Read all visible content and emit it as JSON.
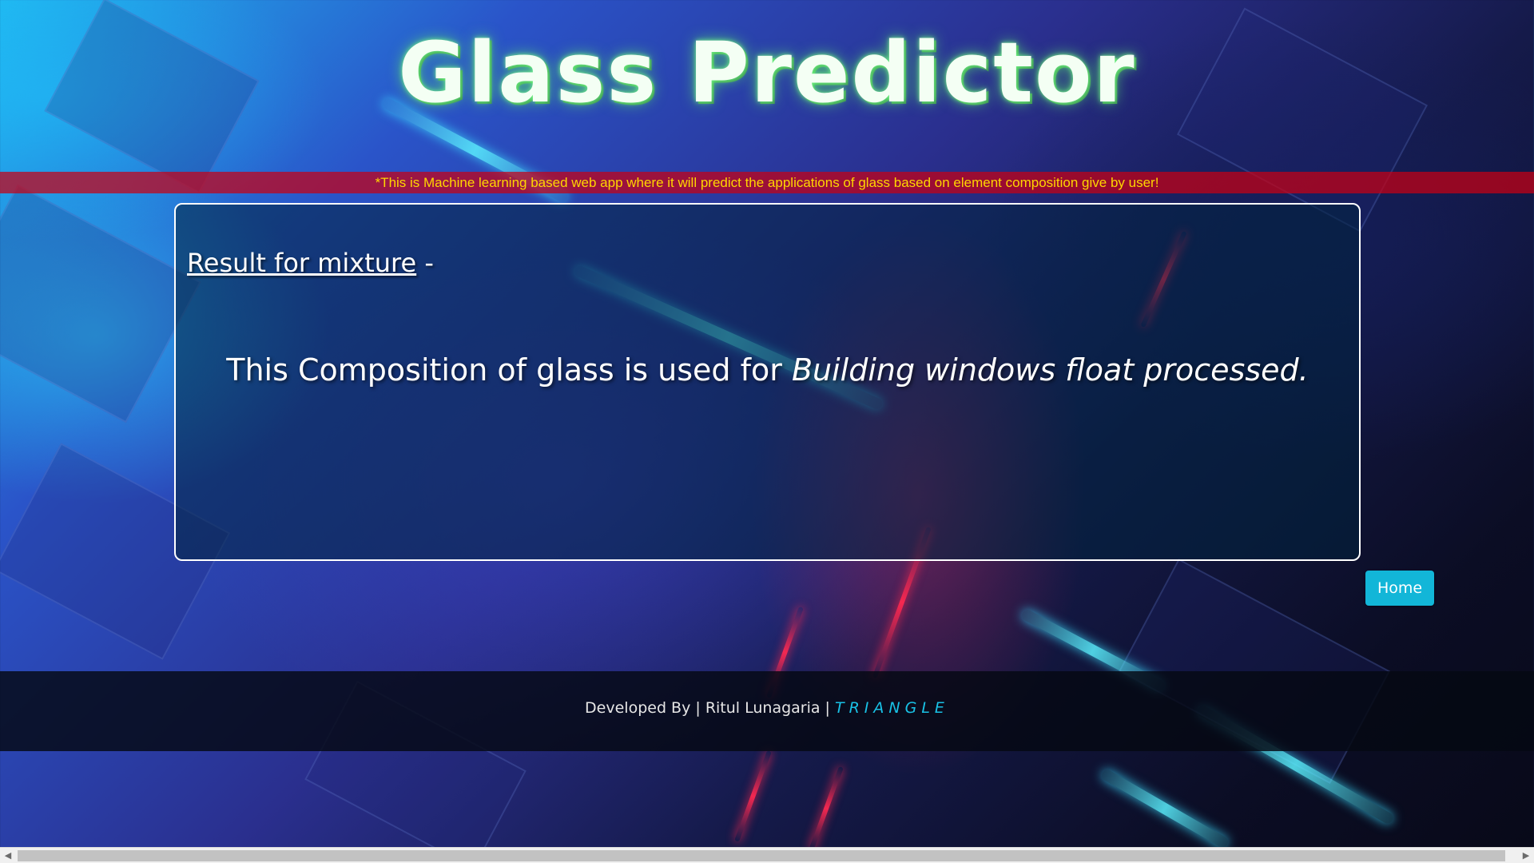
{
  "header": {
    "title": "Glass Predictor",
    "banner_text": "*This is Machine learning based web app where it will predict the applications of glass based on element composition give by user!"
  },
  "result": {
    "heading_label": "Result for mixture",
    "heading_suffix": " -",
    "sentence_prefix": "This Composition of glass is used for ",
    "prediction": "Building windows float processed."
  },
  "actions": {
    "home_label": "Home"
  },
  "footer": {
    "credit": "Developed By | Ritul Lunagaria | ",
    "brand": "TRIANGLE"
  },
  "scrollbar": {
    "left_arrow": "◀",
    "right_arrow": "▶"
  },
  "colors": {
    "banner_bg": "#c80014",
    "banner_text": "#ffd600",
    "button_bg": "#12b6d8",
    "brand": "#19c2e6",
    "title_glow": "#5ae66e"
  }
}
